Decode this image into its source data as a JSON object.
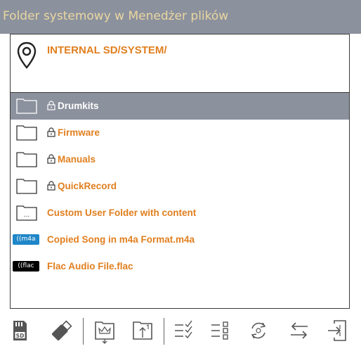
{
  "window": {
    "title": "Folder systemowy w Menedżer plików"
  },
  "colors": {
    "accent": "#e07f1f",
    "titlebar": "#8c919e",
    "title_text": "#e9d7a0",
    "selection": "#8c919e"
  },
  "path": {
    "text": "INTERNAL SD/SYSTEM/",
    "icon": "location-pin-icon"
  },
  "items": [
    {
      "label": "Drumkits",
      "type": "folder",
      "locked": true,
      "selected": true
    },
    {
      "label": "Firmware",
      "type": "folder",
      "locked": true,
      "selected": false
    },
    {
      "label": "Manuals",
      "type": "folder",
      "locked": true,
      "selected": false
    },
    {
      "label": "QuickRecord",
      "type": "folder",
      "locked": true,
      "selected": false
    },
    {
      "label": "Custom User Folder with content",
      "type": "folder-with-content",
      "locked": false,
      "selected": false
    },
    {
      "label": "Copied Song in m4a Format.m4a",
      "type": "m4a",
      "badge": "((m4a",
      "locked": false,
      "selected": false
    },
    {
      "label": "Flac Audio File.flac",
      "type": "flac",
      "badge": "((flac",
      "locked": false,
      "selected": false
    }
  ],
  "folder_content_glyph": "...",
  "toolbar": {
    "sd_label": "SD",
    "buttons": [
      "sd-card-icon",
      "usb-drive-icon",
      "copy-to-folder-icon",
      "upload-folder-icon",
      "select-all-icon",
      "list-view-icon",
      "refresh-icon",
      "swap-icon",
      "export-icon"
    ]
  }
}
